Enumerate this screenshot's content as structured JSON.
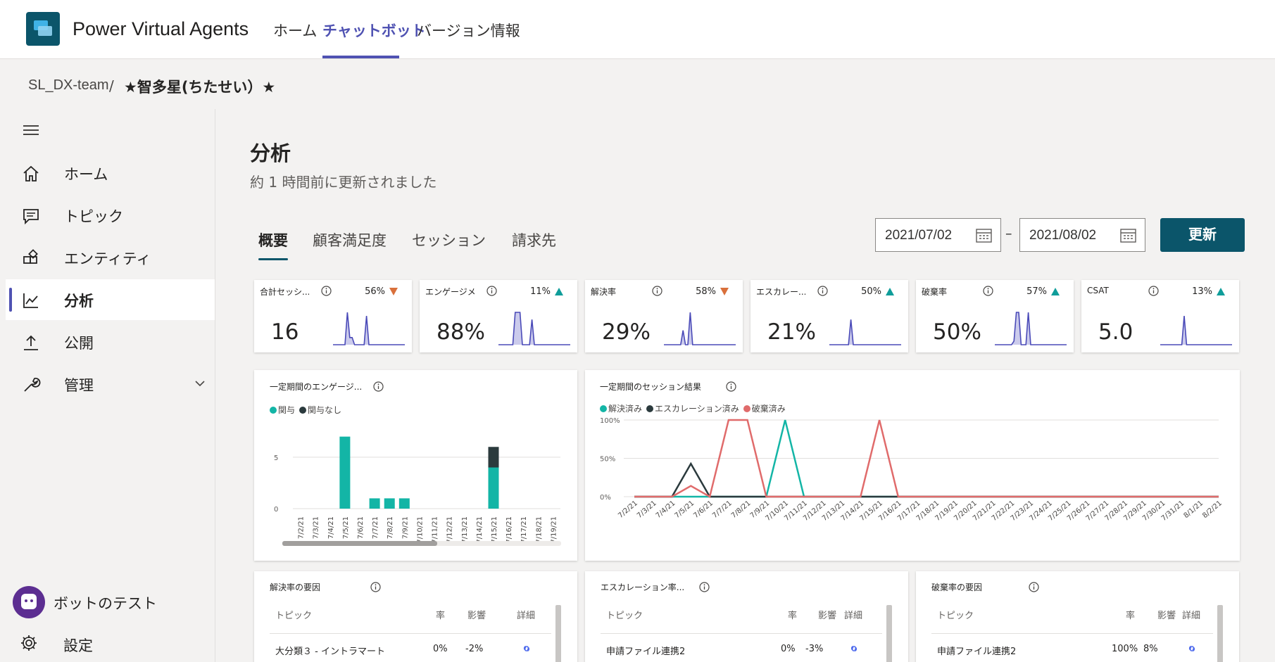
{
  "app": {
    "name": "Power Virtual Agents",
    "nav": [
      "ホーム",
      "チャットボット",
      "バージョン情報"
    ]
  },
  "breadcrumb": {
    "team": "SL_DX-team",
    "sep": "/",
    "bot": "★智多星(ちたせい）★"
  },
  "sidebar": {
    "items": [
      {
        "label": "ホーム",
        "icon": "home-icon"
      },
      {
        "label": "トピック",
        "icon": "chat-icon"
      },
      {
        "label": "エンティティ",
        "icon": "entity-icon"
      },
      {
        "label": "分析",
        "icon": "analytics-icon"
      },
      {
        "label": "公開",
        "icon": "upload-icon"
      },
      {
        "label": "管理",
        "icon": "wrench-icon"
      }
    ],
    "bot_test": "ボットのテスト",
    "settings": "設定"
  },
  "page": {
    "title": "分析",
    "subtitle": "約 1 時間前に更新されました",
    "tabs": [
      "概要",
      "顧客満足度",
      "セッション",
      "請求先"
    ],
    "date_from": "2021/07/02",
    "date_dash": "–",
    "date_to": "2021/08/02",
    "refresh": "更新"
  },
  "colors": {
    "accent": "#0b556a",
    "nav_active": "#4f52b2",
    "teal": "#13b5a6",
    "dark": "#2b3a3d",
    "red": "#e06b6b",
    "spark": "#4a4ab8",
    "up": "#0f9d9a",
    "down": "#d9703b"
  },
  "kpis": [
    {
      "title": "合計セッシ...",
      "pct": "56%",
      "trend": "down",
      "value": "16",
      "spark": [
        0,
        0,
        0,
        0,
        0,
        0,
        9,
        2,
        2,
        0,
        0,
        0,
        0,
        0,
        8,
        0,
        0,
        0,
        0,
        0,
        0,
        0,
        0,
        0,
        0,
        0,
        0,
        0,
        0,
        0,
        0
      ]
    },
    {
      "title": "エンゲージメン...",
      "pct": "11%",
      "trend": "up",
      "value": "88%",
      "spark": [
        0,
        0,
        0,
        0,
        0,
        0,
        0,
        9,
        9,
        9,
        0,
        0,
        0,
        0,
        7,
        0,
        0,
        0,
        0,
        0,
        0,
        0,
        0,
        0,
        0,
        0,
        0,
        0,
        0,
        0,
        0
      ]
    },
    {
      "title": "解決率",
      "pct": "58%",
      "trend": "down",
      "value": "29%",
      "spark": [
        0,
        0,
        0,
        0,
        0,
        0,
        0,
        0,
        4,
        0,
        0,
        9,
        0,
        0,
        0,
        0,
        0,
        0,
        0,
        0,
        0,
        0,
        0,
        0,
        0,
        0,
        0,
        0,
        0,
        0,
        0
      ]
    },
    {
      "title": "エスカレー...",
      "pct": "50%",
      "trend": "up",
      "value": "21%",
      "spark": [
        0,
        0,
        0,
        0,
        0,
        0,
        0,
        0,
        0,
        7,
        0,
        0,
        0,
        0,
        0,
        0,
        0,
        0,
        0,
        0,
        0,
        0,
        0,
        0,
        0,
        0,
        0,
        0,
        0,
        0,
        0
      ]
    },
    {
      "title": "破棄率",
      "pct": "57%",
      "trend": "up",
      "value": "50%",
      "spark": [
        0,
        0,
        0,
        0,
        0,
        0,
        0,
        0,
        1,
        9,
        9,
        0,
        0,
        0,
        9,
        0,
        0,
        0,
        0,
        0,
        0,
        0,
        0,
        0,
        0,
        0,
        0,
        0,
        0,
        0,
        0
      ]
    },
    {
      "title": "CSAT",
      "pct": "13%",
      "trend": "up",
      "value": "5.0",
      "spark": [
        0,
        0,
        0,
        0,
        0,
        0,
        0,
        0,
        0,
        0,
        8,
        0,
        0,
        0,
        0,
        0,
        0,
        0,
        0,
        0,
        0,
        0,
        0,
        0,
        0,
        0,
        0,
        0,
        0,
        0,
        0
      ]
    }
  ],
  "chart_data": [
    {
      "type": "bar",
      "title": "一定期間のエンゲージ...",
      "legend": [
        "関与",
        "関与なし"
      ],
      "categories": [
        "7/2/21",
        "7/3/21",
        "7/4/21",
        "7/5/21",
        "7/6/21",
        "7/7/21",
        "7/8/21",
        "7/9/21",
        "7/10/21",
        "7/11/21",
        "7/12/21",
        "7/13/21",
        "7/14/21",
        "7/15/21",
        "7/16/21",
        "7/17/21",
        "7/18/21",
        "7/19/21"
      ],
      "series": [
        {
          "name": "関与",
          "values": [
            0,
            0,
            0,
            7,
            0,
            1,
            1,
            1,
            0,
            0,
            0,
            0,
            0,
            4,
            0,
            0,
            0,
            0
          ]
        },
        {
          "name": "関与なし",
          "values": [
            0,
            0,
            0,
            0,
            0,
            0,
            0,
            0,
            0,
            0,
            0,
            0,
            0,
            2,
            0,
            0,
            0,
            0
          ]
        }
      ],
      "yticks": [
        "0",
        "5"
      ],
      "ylim": [
        0,
        8
      ]
    },
    {
      "type": "line",
      "title": "一定期間のセッション結果",
      "legend": [
        "解決済み",
        "エスカレーション済み",
        "破棄済み"
      ],
      "categories": [
        "7/2/21",
        "7/3/21",
        "7/4/21",
        "7/5/21",
        "7/6/21",
        "7/7/21",
        "7/8/21",
        "7/9/21",
        "7/10/21",
        "7/11/21",
        "7/12/21",
        "7/13/21",
        "7/14/21",
        "7/15/21",
        "7/16/21",
        "7/17/21",
        "7/18/21",
        "7/19/21",
        "7/20/21",
        "7/21/21",
        "7/22/21",
        "7/23/21",
        "7/24/21",
        "7/25/21",
        "7/26/21",
        "7/27/21",
        "7/28/21",
        "7/29/21",
        "7/30/21",
        "7/31/21",
        "8/1/21",
        "8/2/21"
      ],
      "series": [
        {
          "name": "解決済み",
          "values": [
            0,
            0,
            0,
            0,
            0,
            0,
            0,
            0,
            100,
            0,
            0,
            0,
            0,
            0,
            0,
            0,
            0,
            0,
            0,
            0,
            0,
            0,
            0,
            0,
            0,
            0,
            0,
            0,
            0,
            0,
            0,
            0
          ]
        },
        {
          "name": "エスカレーション済み",
          "values": [
            0,
            0,
            0,
            43,
            0,
            0,
            0,
            0,
            0,
            0,
            0,
            0,
            0,
            0,
            0,
            0,
            0,
            0,
            0,
            0,
            0,
            0,
            0,
            0,
            0,
            0,
            0,
            0,
            0,
            0,
            0,
            0
          ]
        },
        {
          "name": "破棄済み",
          "values": [
            0,
            0,
            0,
            14,
            0,
            100,
            100,
            0,
            0,
            0,
            0,
            0,
            0,
            100,
            0,
            0,
            0,
            0,
            0,
            0,
            0,
            0,
            0,
            0,
            0,
            0,
            0,
            0,
            0,
            0,
            0,
            0
          ]
        }
      ],
      "yticks": [
        "0%",
        "50%",
        "100%"
      ],
      "ylim": [
        0,
        100
      ]
    }
  ],
  "tables": [
    {
      "title": "解決率の要因",
      "cols": [
        "トピック",
        "率",
        "影響",
        "詳細"
      ],
      "row": [
        "大分類３ - イントラマート",
        "0%",
        "-2%"
      ]
    },
    {
      "title": "エスカレーション率...",
      "cols": [
        "トピック",
        "率",
        "影響",
        "詳細"
      ],
      "row": [
        "申請ファイル連携2",
        "0%",
        "-3%"
      ]
    },
    {
      "title": "破棄率の要因",
      "cols": [
        "トピック",
        "率",
        "影響",
        "詳細"
      ],
      "row": [
        "申請ファイル連携2",
        "100%",
        "8%"
      ]
    }
  ]
}
